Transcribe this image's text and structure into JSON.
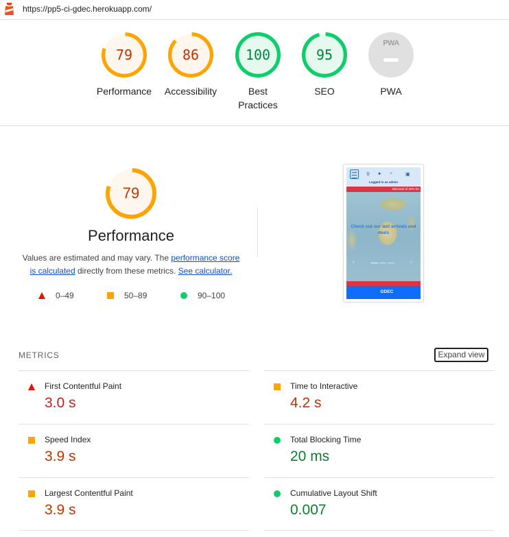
{
  "header": {
    "url": "https://pp5-ci-gdec.herokuapp.com/",
    "logo_icon": "lighthouse-icon"
  },
  "colors": {
    "fail": "#ff4e42",
    "average": "#ffa400",
    "pass": "#0cce6b",
    "fail_text": "#c7221f",
    "average_text": "#c33300",
    "pass_text": "#018642",
    "average_bg": "#fff6ed",
    "pass_bg": "#e5f9ee",
    "pwa_bg": "#e0e0e0",
    "link": "#0c50c7"
  },
  "gauges": [
    {
      "label": "Performance",
      "score": 79,
      "rating": "average"
    },
    {
      "label": "Accessibility",
      "score": 86,
      "rating": "average"
    },
    {
      "label": "Best Practices",
      "score": 100,
      "rating": "pass"
    },
    {
      "label": "SEO",
      "score": 95,
      "rating": "pass"
    },
    {
      "label": "PWA",
      "score": null,
      "rating": "pwa",
      "badge_text": "PWA"
    }
  ],
  "performance": {
    "score": "79",
    "title": "Performance",
    "desc_prefix": "Values are estimated and may vary. The ",
    "link1": "performance score is calculated",
    "desc_middle": " directly from these metrics. ",
    "link2": "See calculator."
  },
  "legend": [
    {
      "shape": "triangle",
      "range": "0–49"
    },
    {
      "shape": "square",
      "range": "50–89"
    },
    {
      "shape": "circle",
      "range": "90–100"
    }
  ],
  "screenshot": {
    "logged_in": "Logged in as admin",
    "banner": "Discount of 20% for",
    "hero": "Check out our last arrivals and deals",
    "footer_brand": "🐾 GDEC",
    "prev": "‹",
    "next": "›",
    "icons": [
      "menu-icon",
      "search-icon",
      "user-icon",
      "list-icon",
      "cart-icon"
    ]
  },
  "metrics": {
    "header": "METRICS",
    "expand_label": "Expand view",
    "items": [
      {
        "title": "First Contentful Paint",
        "value": "3.0 s",
        "rating": "fail"
      },
      {
        "title": "Time to Interactive",
        "value": "4.2 s",
        "rating": "average"
      },
      {
        "title": "Speed Index",
        "value": "3.9 s",
        "rating": "average"
      },
      {
        "title": "Total Blocking Time",
        "value": "20 ms",
        "rating": "pass"
      },
      {
        "title": "Largest Contentful Paint",
        "value": "3.9 s",
        "rating": "average"
      },
      {
        "title": "Cumulative Layout Shift",
        "value": "0.007",
        "rating": "pass"
      }
    ]
  }
}
